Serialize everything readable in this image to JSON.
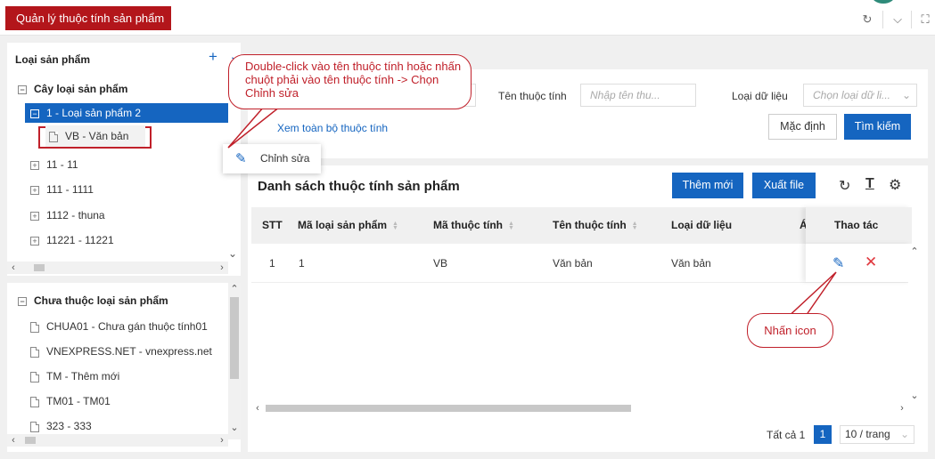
{
  "topbar": {
    "active_tab": "Quản lý thuộc tính sản phẩm",
    "refresh_glyph": "↻",
    "chevron_glyph": "⌵",
    "fullscreen_glyph": "⛶"
  },
  "tree_panel": {
    "title": "Loại sản phẩm",
    "add_glyph": "+",
    "root": {
      "label": "Cây loại sản phẩm",
      "expander": "−"
    },
    "items": [
      {
        "label": "1 - Loại sản phẩm 2",
        "expander": "−",
        "selected": true
      },
      {
        "label": "VB - Văn bản",
        "leaf": true
      },
      {
        "label": "11 - 11",
        "expander": "+"
      },
      {
        "label": "111 - 1111",
        "expander": "+"
      },
      {
        "label": "1112 - thuna",
        "expander": "+"
      },
      {
        "label": "11221 - 11221",
        "expander": "+"
      }
    ]
  },
  "unassigned_panel": {
    "title": "Chưa thuộc loại sản phẩm",
    "expander": "−",
    "items": [
      "CHUA01 - Chưa gán thuộc tính01",
      "VNEXPRESS.NET - vnexpress.net",
      "TM - Thêm mới",
      "TM01 - TM01",
      "323 - 333"
    ]
  },
  "scroll": {
    "left": "‹",
    "right": "›",
    "up": "⌃",
    "down": "⌄"
  },
  "filter": {
    "attr_name_label": "Tên thuộc tính",
    "attr_name_placeholder": "Nhập tên thu...",
    "data_type_label": "Loại dữ liệu",
    "data_type_placeholder": "Chọn loại dữ li...",
    "view_all_link": "Xem toàn bộ thuộc tính",
    "default_button": "Mặc định",
    "search_button": "Tìm kiếm"
  },
  "list": {
    "title": "Danh sách thuộc tính sản phẩm",
    "add_button": "Thêm mới",
    "export_button": "Xuất file",
    "columns": [
      "STT",
      "Mã loại sản phẩm",
      "Mã thuộc tính",
      "Tên thuộc tính",
      "Loại dữ liệu",
      "Á",
      "Thao tác"
    ],
    "rows": [
      {
        "stt": "1",
        "product_type_code": "1",
        "attr_code": "VB",
        "attr_name": "Văn bản",
        "data_type": "Văn bản"
      }
    ],
    "edit_glyph": "✎",
    "delete_glyph": "✕"
  },
  "pagination": {
    "total_label": "Tất cả 1",
    "current_page": "1",
    "page_size": "10 / trang"
  },
  "context_menu": {
    "edit_label": "Chỉnh sửa",
    "edit_glyph": "✎"
  },
  "callouts": {
    "top": "Double-click vào tên thuộc tính hoặc nhấn chuột phải vào tên thuộc tính -> Chọn Chỉnh sửa",
    "bottom": "Nhấn icon"
  },
  "colors": {
    "brand_red": "#b3161b",
    "primary_blue": "#1565c0",
    "callout_red": "#c0202a"
  }
}
